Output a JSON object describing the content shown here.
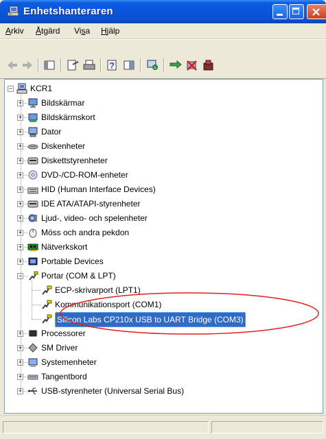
{
  "window": {
    "title": "Enhetshanteraren"
  },
  "menu": [
    {
      "label_pre": "",
      "label_u": "A",
      "label_post": "rkiv"
    },
    {
      "label_pre": "",
      "label_u": "Å",
      "label_post": "tgärd"
    },
    {
      "label_pre": "Vi",
      "label_u": "s",
      "label_post": "a"
    },
    {
      "label_pre": "",
      "label_u": "H",
      "label_post": "jälp"
    }
  ],
  "toolbar": {
    "icons": [
      "back-arrow-icon",
      "forward-arrow-icon",
      "view-icon",
      "properties-icon",
      "print-icon",
      "help-icon",
      "console-icon",
      "scan-hardware-icon",
      "update-driver-icon",
      "disable-icon",
      "uninstall-icon"
    ]
  },
  "tree": {
    "root": "KCR1",
    "items": [
      {
        "label": "Bildskärmar",
        "icon": "monitor-icon"
      },
      {
        "label": "Bildskärmskort",
        "icon": "display-adapter-icon"
      },
      {
        "label": "Dator",
        "icon": "computer-icon"
      },
      {
        "label": "Diskenheter",
        "icon": "disk-drive-icon"
      },
      {
        "label": "Diskettstyrenheter",
        "icon": "floppy-controller-icon"
      },
      {
        "label": "DVD-/CD-ROM-enheter",
        "icon": "cdrom-icon"
      },
      {
        "label": "HID (Human Interface Devices)",
        "icon": "hid-icon"
      },
      {
        "label": "IDE ATA/ATAPI-styrenheter",
        "icon": "ide-controller-icon"
      },
      {
        "label": "Ljud-, video- och spelenheter",
        "icon": "sound-icon"
      },
      {
        "label": "Möss och andra pekdon",
        "icon": "mouse-icon"
      },
      {
        "label": "Nätverkskort",
        "icon": "network-card-icon"
      },
      {
        "label": "Portable Devices",
        "icon": "portable-device-icon"
      },
      {
        "label": "Portar (COM & LPT)",
        "icon": "port-icon",
        "expanded": true,
        "children": [
          {
            "label": "ECP-skrivarport (LPT1)"
          },
          {
            "label": "Kommunikationsport (COM1)"
          },
          {
            "label": "Silicon Labs CP210x USB to UART Bridge (COM3)",
            "selected": true
          }
        ]
      },
      {
        "label": "Processorer",
        "icon": "processor-icon"
      },
      {
        "label": "SM Driver",
        "icon": "sm-driver-icon"
      },
      {
        "label": "Systemenheter",
        "icon": "system-device-icon"
      },
      {
        "label": "Tangentbord",
        "icon": "keyboard-icon"
      },
      {
        "label": "USB-styrenheter (Universal Serial Bus)",
        "icon": "usb-icon"
      }
    ]
  },
  "colors": {
    "titlebar": "#0a55da",
    "selection": "#316ac5",
    "annotation": "#e0201a"
  }
}
